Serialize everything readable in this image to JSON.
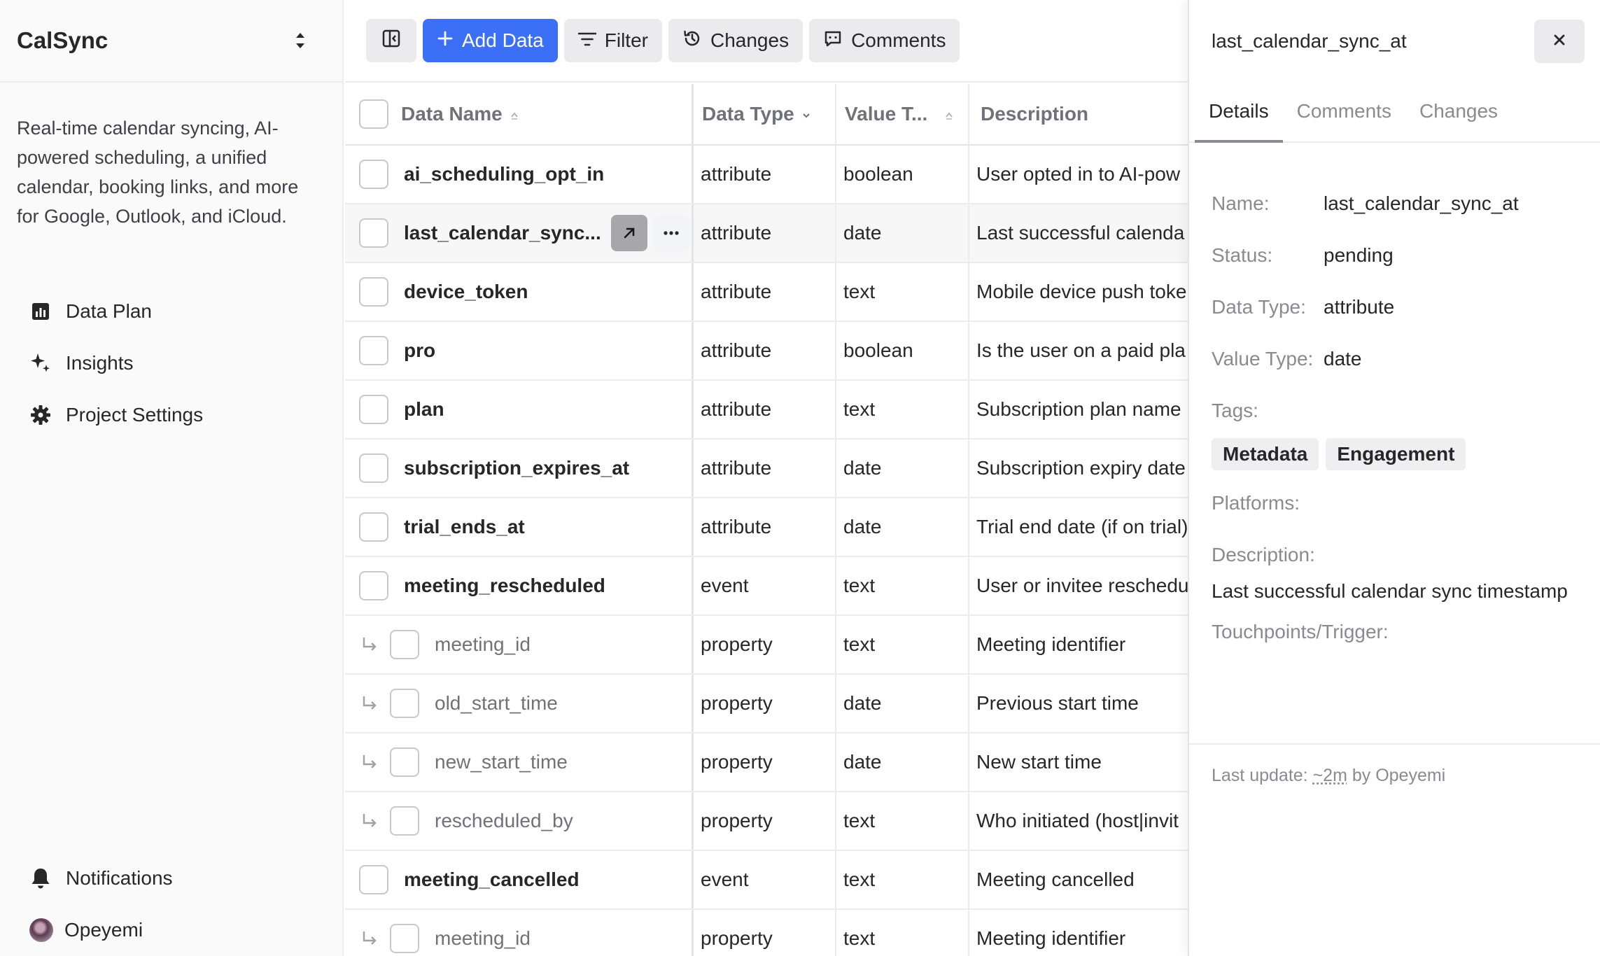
{
  "sidebar": {
    "app_name": "CalSync",
    "description": "Real-time calendar syncing, AI-powered scheduling, a unified calendar, booking links, and more for Google, Outlook, and iCloud.",
    "nav": [
      {
        "label": "Data Plan",
        "icon": "bar-chart-icon"
      },
      {
        "label": "Insights",
        "icon": "sparkle-icon"
      },
      {
        "label": "Project Settings",
        "icon": "gear-icon"
      }
    ],
    "bottom": {
      "notifications": "Notifications",
      "user": "Opeyemi"
    }
  },
  "toolbar": {
    "add_data": "Add Data",
    "filter": "Filter",
    "changes": "Changes",
    "comments": "Comments"
  },
  "table": {
    "columns": [
      "Data Name",
      "Data Type",
      "Value T...",
      "Description"
    ],
    "rows": [
      {
        "name": "ai_scheduling_opt_in",
        "type": "attribute",
        "value_type": "boolean",
        "description": "User opted in to AI-pow",
        "child": false
      },
      {
        "name": "last_calendar_sync...",
        "type": "attribute",
        "value_type": "date",
        "description": "Last successful calenda",
        "child": false,
        "selected": true
      },
      {
        "name": "device_token",
        "type": "attribute",
        "value_type": "text",
        "description": "Mobile device push toke",
        "child": false
      },
      {
        "name": "pro",
        "type": "attribute",
        "value_type": "boolean",
        "description": "Is the user on a paid pla",
        "child": false
      },
      {
        "name": "plan",
        "type": "attribute",
        "value_type": "text",
        "description": "Subscription plan name",
        "child": false
      },
      {
        "name": "subscription_expires_at",
        "type": "attribute",
        "value_type": "date",
        "description": "Subscription expiry date",
        "child": false
      },
      {
        "name": "trial_ends_at",
        "type": "attribute",
        "value_type": "date",
        "description": "Trial end date (if on trial)",
        "child": false
      },
      {
        "name": "meeting_rescheduled",
        "type": "event",
        "value_type": "text",
        "description": "User or invitee reschedu",
        "child": false
      },
      {
        "name": "meeting_id",
        "type": "property",
        "value_type": "text",
        "description": "Meeting identifier",
        "child": true
      },
      {
        "name": "old_start_time",
        "type": "property",
        "value_type": "date",
        "description": "Previous start time",
        "child": true
      },
      {
        "name": "new_start_time",
        "type": "property",
        "value_type": "date",
        "description": "New start time",
        "child": true
      },
      {
        "name": "rescheduled_by",
        "type": "property",
        "value_type": "text",
        "description": "Who initiated (host|invit",
        "child": true
      },
      {
        "name": "meeting_cancelled",
        "type": "event",
        "value_type": "text",
        "description": "Meeting cancelled",
        "child": false
      },
      {
        "name": "meeting_id",
        "type": "property",
        "value_type": "text",
        "description": "Meeting identifier",
        "child": true
      }
    ]
  },
  "panel": {
    "title": "last_calendar_sync_at",
    "tabs": [
      "Details",
      "Comments",
      "Changes"
    ],
    "active_tab": "Details",
    "fields": {
      "name_label": "Name:",
      "name": "last_calendar_sync_at",
      "status_label": "Status:",
      "status": "pending",
      "data_type_label": "Data Type:",
      "data_type": "attribute",
      "value_type_label": "Value Type:",
      "value_type": "date",
      "tags_label": "Tags:",
      "tags": [
        "Metadata",
        "Engagement"
      ],
      "platforms_label": "Platforms:",
      "description_label": "Description:",
      "description": "Last successful calendar sync timestamp",
      "touchpoints_label": "Touchpoints/Trigger:"
    },
    "footer": {
      "prefix": "Last update: ",
      "time": "~2m",
      "suffix": " by Opeyemi"
    }
  },
  "colors": {
    "primary": "#3b6ff5",
    "selected_row": "#dbe6fb"
  }
}
